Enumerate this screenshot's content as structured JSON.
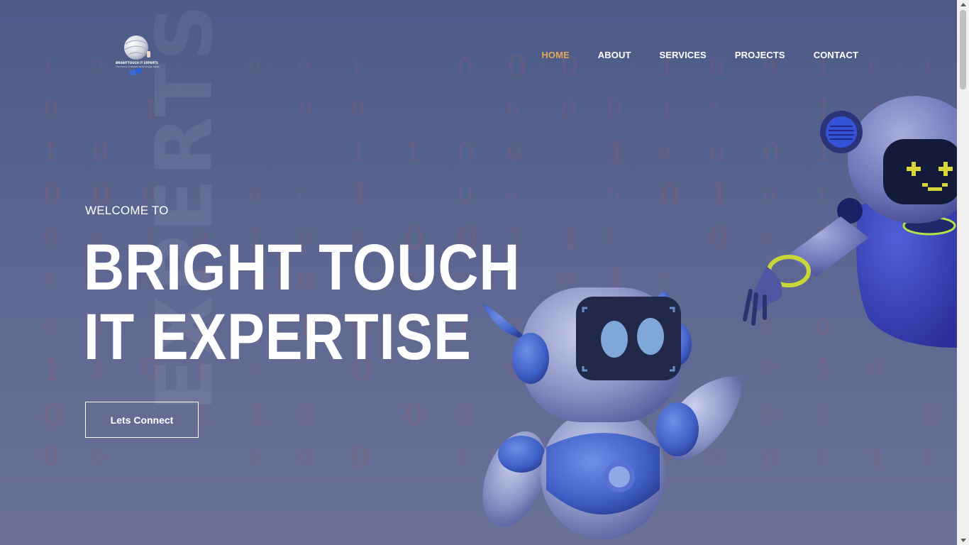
{
  "logo": {
    "name": "BRIGHTTOUCH IT EXPERTS",
    "tagline": "The Future of Wreath Technologies Starts"
  },
  "nav": {
    "items": [
      {
        "label": "HOME",
        "active": true
      },
      {
        "label": "ABOUT",
        "active": false
      },
      {
        "label": "SERVICES",
        "active": false
      },
      {
        "label": "PROJECTS",
        "active": false
      },
      {
        "label": "CONTACT",
        "active": false
      }
    ]
  },
  "hero": {
    "background_word": "EXPERTS",
    "welcome": "WELCOME TO",
    "title_line1": "BRIGHT TOUCH",
    "title_line2": "IT EXPERTISE",
    "cta_label": "Lets Connect"
  },
  "colors": {
    "accent": "#e2a65c",
    "background_top": "#4b5a86",
    "background_bottom": "#6b7197",
    "text": "#ffffff"
  }
}
